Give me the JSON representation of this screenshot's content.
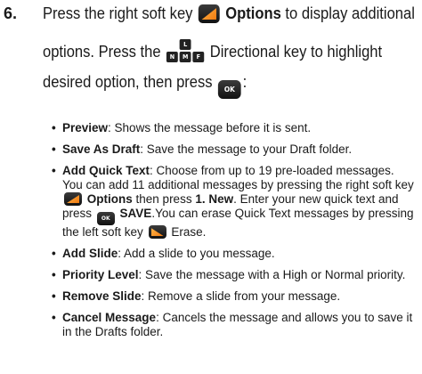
{
  "step": {
    "number": "6.",
    "line1_a": "Press the right soft key",
    "line1_b": "Options",
    "line1_c": "to display additional",
    "line2_a": "options. Press the",
    "line2_b": "Directional key to highlight",
    "line3_a": "desired option, then press",
    "line3_b": ":",
    "dpad_labels": [
      "L",
      "N",
      "M",
      "F"
    ],
    "ok_label": "OK"
  },
  "options": [
    {
      "title": "Preview",
      "text": ": Shows the message before it is sent."
    },
    {
      "title": "Save As Draft",
      "text": ": Save the message to your Draft folder."
    },
    {
      "title": "Add Quick Text",
      "text": ": Choose from up to 19 pre-loaded messages. You can add 11 additional messages by pressing the right soft key",
      "b2": "Options",
      "t2": "then press",
      "b3": "1. New",
      "t3": ". Enter your new quick text and press",
      "b4": "SAVE",
      "t4": ".You can erase Quick Text messages by pressing the left soft key",
      "t5": "Erase."
    },
    {
      "title": "Add Slide",
      "text": ": Add a slide to you message."
    },
    {
      "title": "Priority Level",
      "text": ": Save the message with a High or Normal priority."
    },
    {
      "title": "Remove Slide",
      "text": ": Remove a slide from your message."
    },
    {
      "title": "Cancel Message",
      "text": ": Cancels the message and allows you to save it in the Drafts folder."
    }
  ]
}
